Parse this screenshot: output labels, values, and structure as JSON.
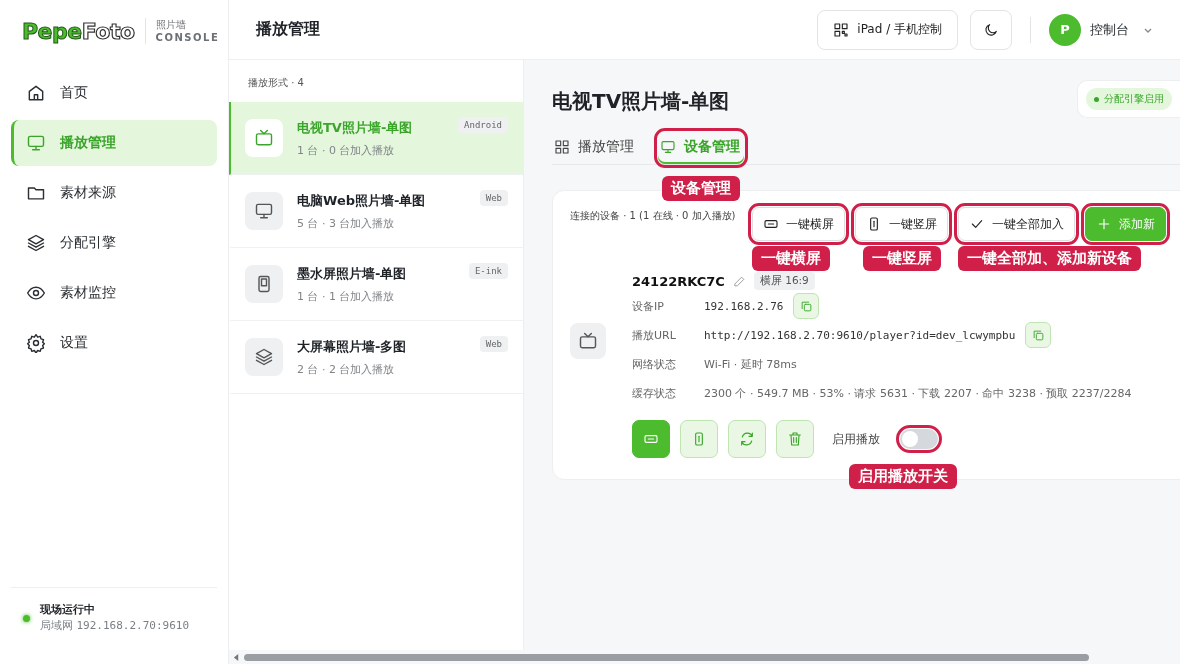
{
  "brand": {
    "logo": [
      "Pepe",
      "Foto"
    ],
    "subtitle": "照片墙",
    "console": "CONSOLE"
  },
  "nav": [
    {
      "label": "首页",
      "selected": false
    },
    {
      "label": "播放管理",
      "selected": true
    },
    {
      "label": "素材来源",
      "selected": false
    },
    {
      "label": "分配引擎",
      "selected": false
    },
    {
      "label": "素材监控",
      "selected": false
    },
    {
      "label": "设置",
      "selected": false
    }
  ],
  "status": {
    "title": "现场运行中",
    "network": "局域网",
    "address": "192.168.2.70:9610",
    "online": true
  },
  "header": {
    "title": "播放管理",
    "remote": "iPad / 手机控制",
    "avatar": "P",
    "user": "控制台"
  },
  "list": {
    "heading": "播放形式 · 4",
    "items": [
      {
        "title": "电视TV照片墙-单图",
        "meta": "1 台 · 0 台加入播放",
        "tag": "Android",
        "selected": true
      },
      {
        "title": "电脑Web照片墙-单图",
        "meta": "5 台 · 3 台加入播放",
        "tag": "Web",
        "selected": false
      },
      {
        "title": "墨水屏照片墙-单图",
        "meta": "1 台 · 1 台加入播放",
        "tag": "E-ink",
        "selected": false
      },
      {
        "title": "大屏幕照片墙-多图",
        "meta": "2 台 · 2 台加入播放",
        "tag": "Web",
        "selected": false
      }
    ]
  },
  "detail": {
    "title": "电视TV照片墙-单图",
    "badge": "分配引擎启用",
    "tabs": [
      {
        "label": "播放管理",
        "selected": false,
        "highlighted": false
      },
      {
        "label": "设备管理",
        "selected": true,
        "highlighted": true
      }
    ],
    "summary": "连接的设备 · 1 (1 在线 · 0 加入播放)",
    "actions": [
      {
        "kind": "outline",
        "label": "一键横屏",
        "highlighted": true
      },
      {
        "kind": "outline",
        "label": "一键竖屏",
        "highlighted": true
      },
      {
        "kind": "outline",
        "label": "一键全部加入",
        "highlighted": true
      },
      {
        "kind": "primary",
        "label": "添加新",
        "highlighted": true
      }
    ],
    "device": {
      "name": "24122RKC7C",
      "orientation": "横屏 16:9",
      "fields": [
        {
          "kind": "copyable",
          "label": "设备IP",
          "value": "192.168.2.76"
        },
        {
          "kind": "copyable",
          "label": "播放URL",
          "value": "http://192.168.2.70:9610/player?id=dev_lcwympbu"
        },
        {
          "kind": "text",
          "label": "网络状态",
          "value": "Wi-Fi · 延时 78ms"
        },
        {
          "kind": "text",
          "label": "缓存状态",
          "value": "2300 个 · 549.7 MB · 53% · 请求 5631 · 下载 2207 · 命中 3238 · 预取 2237/2284"
        }
      ],
      "controls": [
        {
          "selected": true
        },
        {
          "selected": false
        },
        {
          "selected": false
        },
        {
          "selected": false
        }
      ],
      "toggle": {
        "label": "启用播放",
        "on": false
      },
      "toggle_highlighted": true
    }
  },
  "annotations": [
    {
      "label": "设备管理"
    },
    {
      "label": "一键横屏"
    },
    {
      "label": "一键竖屏"
    },
    {
      "label": "一键全部加、添加新设备"
    },
    {
      "label": "启用播放开关"
    }
  ]
}
